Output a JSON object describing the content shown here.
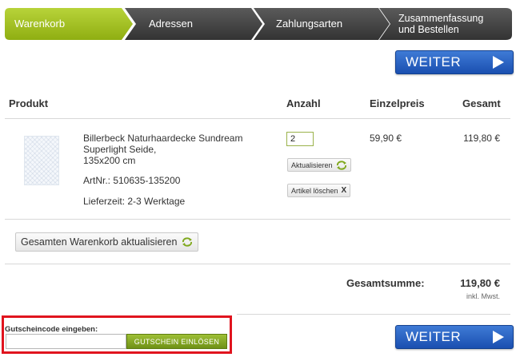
{
  "steps": [
    {
      "label": "Warenkorb",
      "active": true
    },
    {
      "label": "Adressen",
      "active": false
    },
    {
      "label": "Zahlungsarten",
      "active": false
    },
    {
      "label_line1": "Zusammenfassung",
      "label_line2": "und Bestellen",
      "active": false
    }
  ],
  "weiter_label": "WEITER",
  "table": {
    "col_product": "Produkt",
    "col_qty": "Anzahl",
    "col_unit": "Einzelpreis",
    "col_total": "Gesamt"
  },
  "item": {
    "name_line1": "Billerbeck Naturhaardecke Sundream",
    "name_line2": "Superlight Seide,",
    "name_line3": "135x200 cm",
    "artnr": "ArtNr.: 510635-135200",
    "delivery": "Lieferzeit: 2-3 Werktage",
    "qty": "2",
    "update_label": "Aktualisieren",
    "delete_label": "Artikel löschen",
    "delete_mark": "X",
    "unit_price": "59,90 €",
    "total_price": "119,80 €"
  },
  "update_cart_label": "Gesamten Warenkorb aktualisieren",
  "summary": {
    "label": "Gesamtsumme:",
    "value": "119,80 €",
    "tax_note": "inkl. Mwst."
  },
  "coupon": {
    "label": "Gutscheincode eingeben:",
    "value": "",
    "button_label": "GUTSCHEIN EINLÖSEN"
  },
  "colors": {
    "active_step": "#a6c424",
    "inactive_step": "#4a4a4a",
    "weiter_button": "#2a62c6",
    "coupon_button": "#86a826",
    "highlight_border": "#e0141e"
  }
}
